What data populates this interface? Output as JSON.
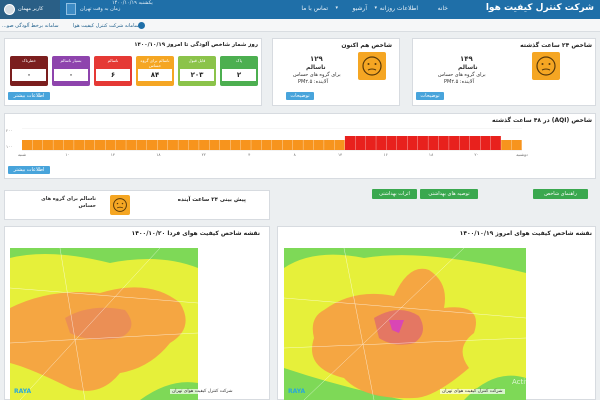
{
  "header": {
    "brand": "شرکت کنترل کیفیت هوا",
    "nav": [
      "خانه",
      "اطلاعات روزانه",
      "آرشیو",
      "تماس با ما"
    ],
    "date": "یکشنبه ۱۴۰۰/۱۰/۱۹",
    "timezone": "زمان به وقت تهران",
    "user": "کاربر مهمان",
    "nav_arrow": "▾"
  },
  "subbar": {
    "text": "سامانه شرکت کنترل کیفیت هوا",
    "text2": "سامانه برخط آلودگی صو..."
  },
  "cards": {
    "past24": {
      "title": "شاخص ۲۴ ساعت گذشته",
      "value": "۱۴۹",
      "status": "ناسالم",
      "group": "برای گروه های حساس",
      "pollutant": "آلاینده: PM۲.۵",
      "button": "توضیحات",
      "color": "#f5a623"
    },
    "now": {
      "title": "شاخص هم اکنون",
      "value": "۱۲۹",
      "status": "ناسالم",
      "group": "برای گروه های حساس",
      "pollutant": "آلاینده: PM۲.۵",
      "button": "توضیحات",
      "color": "#f5a623"
    },
    "days": {
      "title": "روز شمار شاخص آلودگی تا امروز ۱۴۰۰/۱۰/۱۹",
      "button": "اطلاعات بیشتر",
      "categories": [
        {
          "label": "پاک",
          "value": "۲",
          "color": "#4caf50"
        },
        {
          "label": "قابل قبول",
          "value": "۲۰۳",
          "color": "#8bc34a"
        },
        {
          "label": "ناسالم برای گروه حساس",
          "value": "۸۴",
          "color": "#f5a623"
        },
        {
          "label": "ناسالم",
          "value": "۶",
          "color": "#e53935"
        },
        {
          "label": "بسیار ناسالم",
          "value": "۰",
          "color": "#8e44ad"
        },
        {
          "label": "خطرناک",
          "value": "۰",
          "color": "#7b1e1e"
        }
      ]
    }
  },
  "aqi48": {
    "title": "شاخص (AQI) در ۴۸ ساعت گذشته",
    "button": "اطلاعات بیشتر",
    "ymax": "۲۰۰",
    "ymid": "۱۰۰",
    "xticks": [
      "دوشنبه",
      "",
      "۲۰",
      "",
      "۱۸",
      "",
      "۱۶",
      "",
      "۱۴",
      "",
      "۸",
      "",
      "۴",
      "",
      "۲۲",
      "",
      "۱۸",
      "",
      "۱۴",
      "",
      "۱۰",
      "",
      "شنبه"
    ]
  },
  "forecast": {
    "title": "پیش بینی ۲۴ ساعت آینده",
    "status": "ناسالم برای گروه های حساس"
  },
  "tabs": [
    "راهنمای شاخص",
    "توصیه های بهداشتی",
    "اثرات بهداشتی"
  ],
  "maps": {
    "today": {
      "title": "نقشه شاخص کیفیت هوای امروز ۱۴۰۰/۱۰/۱۹",
      "caption": "شرکت کنترل کیفیت هوای تهران",
      "logo": "RAYA"
    },
    "tomorrow": {
      "title": "نقشه شاخص کیفیت هوای فردا ۱۴۰۰/۱۰/۲۰",
      "caption": "شرکت کنترل کیفیت هوای تهران",
      "logo": "RAYA"
    }
  },
  "watermark": "Activate Windows"
}
